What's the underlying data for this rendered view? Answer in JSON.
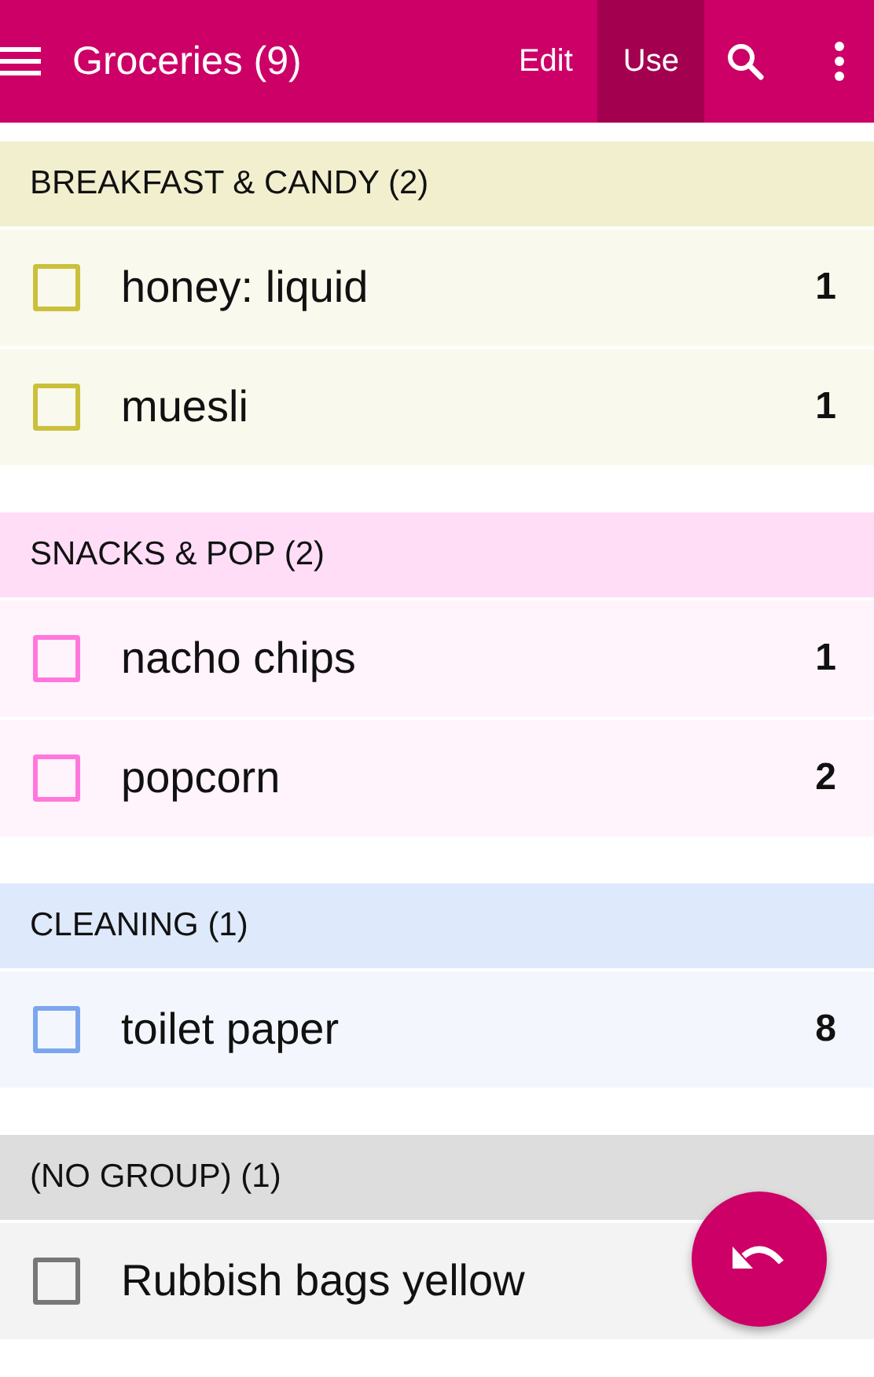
{
  "app_bar": {
    "title": "Groceries (9)",
    "tabs": [
      {
        "label": "Edit",
        "selected": false
      },
      {
        "label": "Use",
        "selected": true
      }
    ]
  },
  "groups": [
    {
      "title": "BREAKFAST & CANDY (2)",
      "color": "#cbc03c",
      "items": [
        {
          "name": "honey: liquid",
          "quantity": "1",
          "checked": false
        },
        {
          "name": "muesli",
          "quantity": "1",
          "checked": false
        }
      ]
    },
    {
      "title": "SNACKS & POP (2)",
      "color": "#ff77dd",
      "items": [
        {
          "name": "nacho chips",
          "quantity": "1",
          "checked": false
        },
        {
          "name": "popcorn",
          "quantity": "2",
          "checked": false
        }
      ]
    },
    {
      "title": "CLEANING (1)",
      "color": "#7ba6ee",
      "items": [
        {
          "name": "toilet paper",
          "quantity": "8",
          "checked": false
        }
      ]
    },
    {
      "title": "(NO GROUP) (1)",
      "color": "#777777",
      "items": [
        {
          "name": "Rubbish bags yellow",
          "checked": false
        }
      ]
    }
  ]
}
